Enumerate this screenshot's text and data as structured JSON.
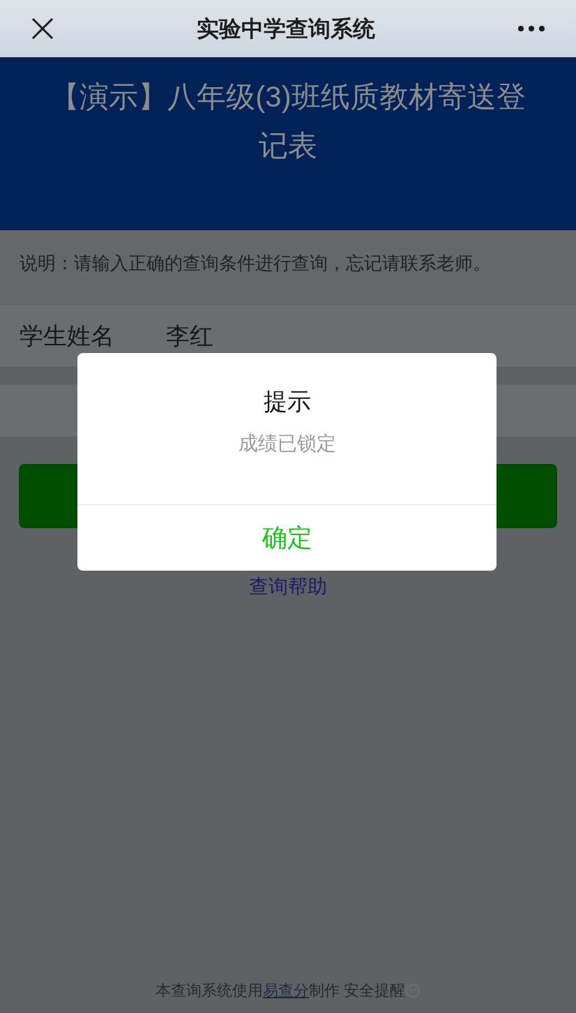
{
  "header": {
    "title": "实验中学查询系统"
  },
  "banner": {
    "title": "【演示】八年级(3)班纸质教材寄送登记表"
  },
  "notice": "说明：请输入正确的查询条件进行查询，忘记请联系老师。",
  "fields": [
    {
      "label": "学生姓名",
      "value": "李红"
    }
  ],
  "help_link": "查询帮助",
  "footer": {
    "prefix": "本查询系统使用",
    "link": "易查分",
    "suffix": "制作 安全提醒"
  },
  "dialog": {
    "title": "提示",
    "message": "成绩已锁定",
    "confirm": "确定"
  }
}
